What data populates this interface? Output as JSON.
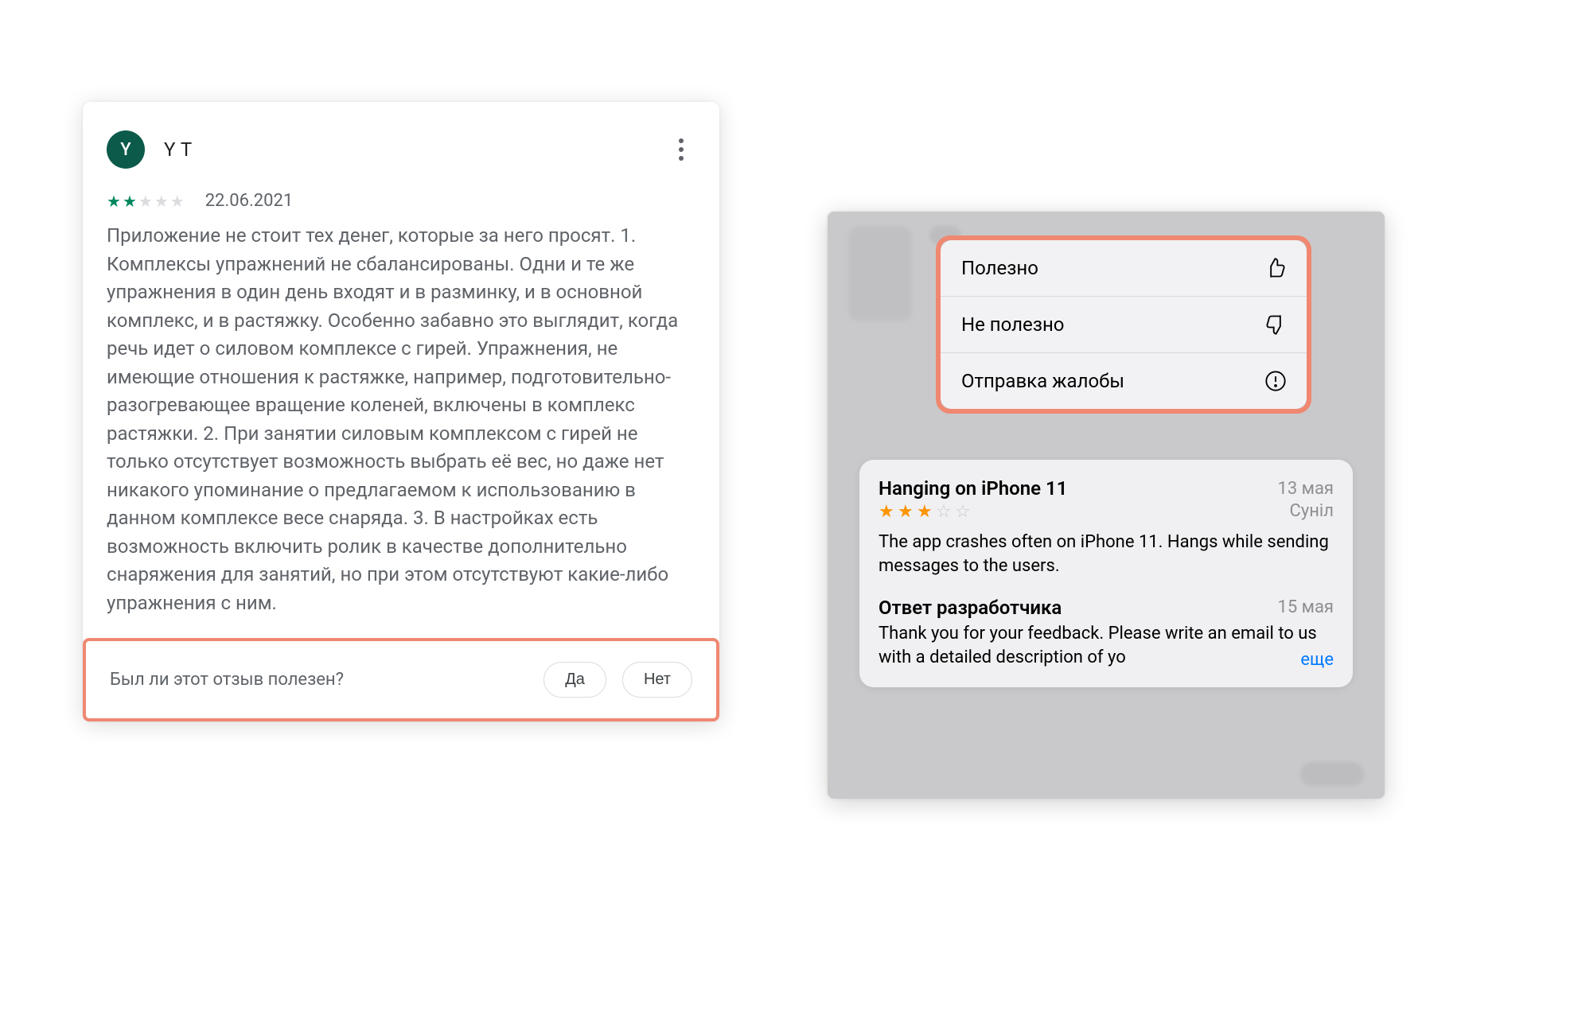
{
  "google_play_review": {
    "avatar_initial": "Y",
    "username": "Y T",
    "rating": 2,
    "max_rating": 5,
    "date": "22.06.2021",
    "body": "Приложение не стоит тех денег, которые за него просят. 1. Комплексы упражнений не сбалансированы. Одни и те же упражнения в один день входят и в разминку, и в основной комплекс, и в растяжку. Особенно забавно это выглядит, когда речь идет о силовом комплексе с гирей. Упражнения, не имеющие отношения к растяжке, например, подготовительно-разогревающее вращение коленей, включены в комплекс растяжки. 2. При занятии силовым комплексом с гирей не только отсутствует возможность выбрать её вес, но даже нет никакого упоминание о предлагаемом к использованию в данном комплексе весе снаряда. 3. В настройках есть возможность включить ролик в качестве дополнительно снаряжения для занятий, но при этом отсутствуют какие-либо упражнения с ним.",
    "helpful_question": "Был ли этот отзыв полезен?",
    "yes_label": "Да",
    "no_label": "Нет"
  },
  "app_store": {
    "menu": {
      "helpful": "Полезно",
      "not_helpful": "Не полезно",
      "report": "Отправка жалобы"
    },
    "review": {
      "title": "Hanging on iPhone 11",
      "date": "13 мая",
      "rating": 3,
      "max_rating": 5,
      "author": "Суніл",
      "body": "The app crashes often on iPhone 11. Hangs while sending messages to the users.",
      "dev_title": "Ответ разработчика",
      "dev_date": "15 мая",
      "dev_body": "Thank you for your feedback. Please write an email to us with a detailed description of yo",
      "more_label": "еще"
    }
  },
  "colors": {
    "highlight_border": "#f08871",
    "gp_star_on": "#01875f",
    "as_star_on": "#ff9500",
    "ios_link": "#007aff"
  }
}
